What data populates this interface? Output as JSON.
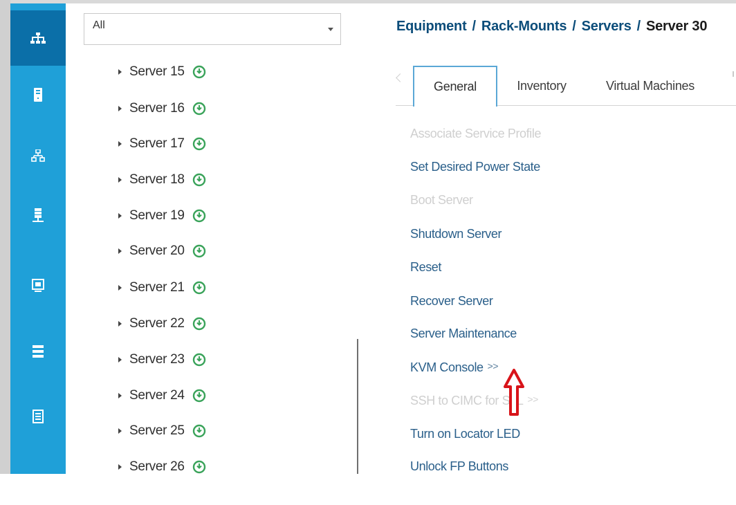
{
  "filter": {
    "selected": "All"
  },
  "tree": {
    "items": [
      {
        "label": "Server 15"
      },
      {
        "label": "Server 16"
      },
      {
        "label": "Server 17"
      },
      {
        "label": "Server 18"
      },
      {
        "label": "Server 19"
      },
      {
        "label": "Server 20"
      },
      {
        "label": "Server 21"
      },
      {
        "label": "Server 22"
      },
      {
        "label": "Server 23"
      },
      {
        "label": "Server 24"
      },
      {
        "label": "Server 25"
      },
      {
        "label": "Server 26"
      }
    ]
  },
  "rail": {
    "items": [
      {
        "icon": "equipment-icon",
        "active": true
      },
      {
        "icon": "server-icon"
      },
      {
        "icon": "lan-network-icon"
      },
      {
        "icon": "san-storage-icon"
      },
      {
        "icon": "vm-monitor-icon"
      },
      {
        "icon": "storage-stack-icon"
      },
      {
        "icon": "admin-list-icon"
      },
      {
        "icon": "admin-icon"
      }
    ]
  },
  "breadcrumb": {
    "parts": [
      "Equipment",
      "Rack-Mounts",
      "Servers"
    ],
    "current": "Server 30",
    "separator": "/"
  },
  "tabs": [
    {
      "label": "General",
      "active": true
    },
    {
      "label": "Inventory"
    },
    {
      "label": "Virtual Machines"
    }
  ],
  "actions": [
    {
      "label": "Associate Service Profile",
      "enabled": false
    },
    {
      "label": "Set Desired Power State",
      "enabled": true
    },
    {
      "label": "Boot Server",
      "enabled": false
    },
    {
      "label": "Shutdown Server",
      "enabled": true
    },
    {
      "label": "Reset",
      "enabled": true
    },
    {
      "label": "Recover Server",
      "enabled": true
    },
    {
      "label": "Server Maintenance",
      "enabled": true
    },
    {
      "label": "KVM Console",
      "enabled": true,
      "suffix": ">>"
    },
    {
      "label": "SSH to CIMC for SoL",
      "enabled": false,
      "suffix": ">>"
    },
    {
      "label": "Turn on Locator LED",
      "enabled": true
    },
    {
      "label": "Unlock FP Buttons",
      "enabled": true
    }
  ],
  "colors": {
    "rail": "#1fa0d8",
    "rail_active": "#0b6fa8",
    "status_green": "#3aa35a",
    "link": "#2a5f8a",
    "annotation_red": "#d8141a"
  }
}
